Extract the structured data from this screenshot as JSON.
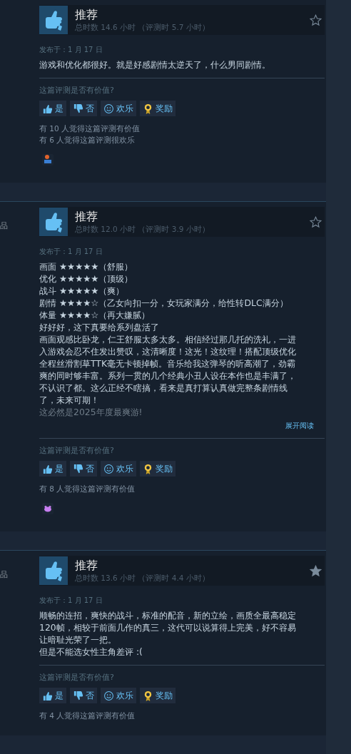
{
  "reviews": [
    {
      "verdict": "推荐",
      "hours": "总时数 14.6 小时 （评测时 5.7 小时）",
      "starred": false,
      "posted": "发布于：1 月 17 日",
      "lines": [
        "游戏和优化都很好。就是好感剧情太逆天了，什么男同剧情。"
      ],
      "question": "这篇评测是否有价值?",
      "buttons": [
        {
          "kind": "yes",
          "label": "是"
        },
        {
          "kind": "no",
          "label": "否"
        },
        {
          "kind": "funny",
          "label": "欢乐"
        },
        {
          "kind": "award",
          "label": "奖励"
        }
      ],
      "counts": [
        "有 10 人觉得这篇评测有价值",
        "有 6 人觉得这篇评测很欢乐"
      ],
      "awards": [
        {
          "kind": "figure"
        }
      ]
    },
    {
      "side_text": "品",
      "verdict": "推荐",
      "hours": "总时数 12.0 小时 （评测时 3.9 小时）",
      "starred": false,
      "posted": "发布于：1 月 17 日",
      "lines": [
        "画面 ★★★★★（舒服）",
        "优化 ★★★★★（顶级）",
        "战斗 ★★★★★（爽）",
        "剧情 ★★★★☆（乙女向扣一分，女玩家满分，给性转DLC满分）",
        "体量 ★★★★☆（再大嫌腻）",
        "好好好，这下真要给系列盘活了",
        "画面观感比卧龙，仁王舒服太多太多。相信经过那几托的洗礼，一进",
        "入游戏会忍不住发出赞叹，这清晰度！这光！这纹理！搭配顶级优化",
        "全程丝滑割草TTK毫无卡顿掉帧。音乐给我这弹琴的听高潮了，劲霸",
        "爽的同时够丰富。系列一贯的几个经典小丑人设在本作也是丰满了，",
        "不认识了都。这么正经不瞎搞，看来是真打算认真做完整条剧情线",
        "了，未来可期！"
      ],
      "faded_line": "这必然是2025年度最爽游!",
      "expand_link": "展开阅读",
      "question": "这篇评测是否有价值?",
      "buttons": [
        {
          "kind": "yes",
          "label": "是"
        },
        {
          "kind": "no",
          "label": "否"
        },
        {
          "kind": "funny",
          "label": "欢乐"
        },
        {
          "kind": "award",
          "label": "奖励"
        }
      ],
      "counts": [
        "有 8 人觉得这篇评测有价值"
      ],
      "awards": [
        {
          "kind": "paws"
        }
      ]
    },
    {
      "side_text": "品",
      "verdict": "推荐",
      "hours": "总时数 13.6 小时 （评测时 4.4 小时）",
      "starred": true,
      "posted": "发布于：1 月 17 日",
      "lines": [
        "顺畅的连招，爽快的战斗，标准的配音，新的立绘，画质全最高稳定",
        "120帧，相较于前面几作的真三，这代可以说算得上完美，好不容易",
        "让暗耻光荣了一把。",
        "但是不能选女性主角差评 :("
      ],
      "question": "这篇评测是否有价值?",
      "buttons": [
        {
          "kind": "yes",
          "label": "是"
        },
        {
          "kind": "no",
          "label": "否"
        },
        {
          "kind": "funny",
          "label": "欢乐"
        },
        {
          "kind": "award",
          "label": "奖励"
        }
      ],
      "counts": [
        "有 4 人觉得这篇评测有价值"
      ]
    }
  ]
}
